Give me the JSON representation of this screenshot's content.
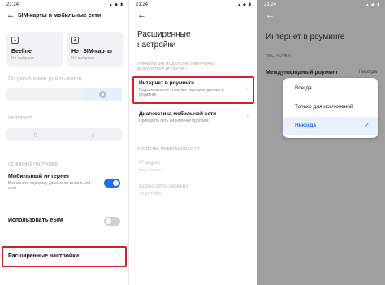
{
  "screen1": {
    "time": "21:24",
    "status_icons": "▴ ◆ ▮",
    "title": "SIM-карты и мобильные сети",
    "sim1": {
      "badge": "1",
      "name": "Beeline",
      "sub": "Не выбрано"
    },
    "sim2": {
      "badge": "2",
      "name": "Нет SIM-карты",
      "sub": "Не выбрано"
    },
    "default_calls_label": "По умолчанию для вызовов",
    "internet_label": "Интернет",
    "basic_settings_label": "Основные настройки",
    "mobile_internet": {
      "title": "Мобильный интернет",
      "sub": "Разрешить передачу данных по мобильной сети",
      "enabled": true
    },
    "esim": {
      "title": "Использовать eSIM",
      "enabled": false
    },
    "advanced_settings": "Расширенные настройки",
    "highlight_color": "#d6202a"
  },
  "screen2": {
    "time": "21:24",
    "title": "Расширенные настройки",
    "section_roaming": "Управление подключением через мобильный интернет",
    "roaming": {
      "title": "Интернет в роуминге",
      "sub": "Подключаться к службам передачи данных в роуминге"
    },
    "diagnostics": {
      "title": "Диагностика мобильной сети",
      "sub": "Проверить сеть на наличие проблем"
    },
    "section_props": "Свойства мобильной сети",
    "ip": {
      "title": "IP-адрес",
      "sub": "Недоступно"
    },
    "dns": {
      "title": "Адрес DNS-сервера",
      "sub": "Недоступно"
    }
  },
  "screen3": {
    "time": "21:24",
    "title": "Интернет в роуминге",
    "section": "Настройки",
    "row_title": "Международный роуминг",
    "row_value": "Никогда",
    "options": [
      "Всегда",
      "Только для исключений",
      "Никогда"
    ],
    "selected": "Никогда",
    "accent": "#1e6fe6"
  }
}
